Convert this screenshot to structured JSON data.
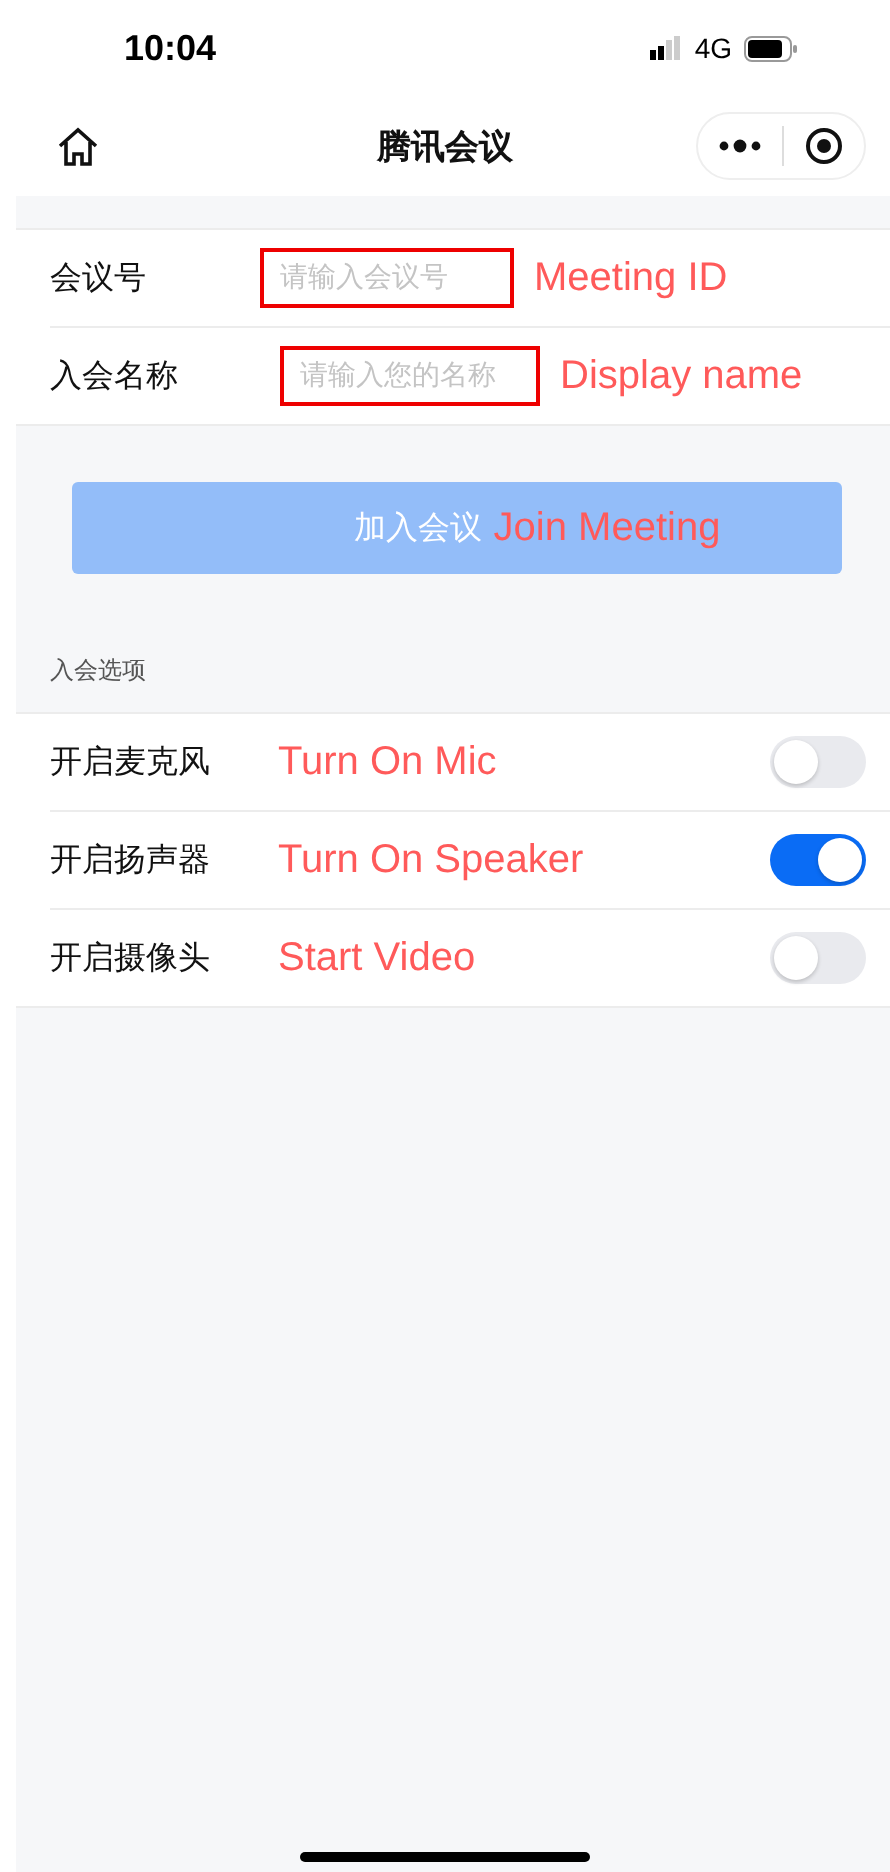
{
  "status_bar": {
    "time": "10:04",
    "network": "4G"
  },
  "nav_bar": {
    "title": "腾讯会议"
  },
  "form": [
    {
      "label": "会议号",
      "placeholder": "请输入会议号",
      "annotation": "Meeting ID"
    },
    {
      "label": "入会名称",
      "placeholder": "请输入您的名称",
      "annotation": "Display name"
    }
  ],
  "join_button": {
    "label": "加入会议",
    "annotation": "Join Meeting",
    "disabled": true
  },
  "options_section": {
    "title": "入会选项"
  },
  "options": [
    {
      "label": "开启麦克风",
      "annotation": "Turn On Mic",
      "on": false
    },
    {
      "label": "开启扬声器",
      "annotation": "Turn On Speaker",
      "on": true
    },
    {
      "label": "开启摄像头",
      "annotation": "Start Video",
      "on": false
    }
  ]
}
